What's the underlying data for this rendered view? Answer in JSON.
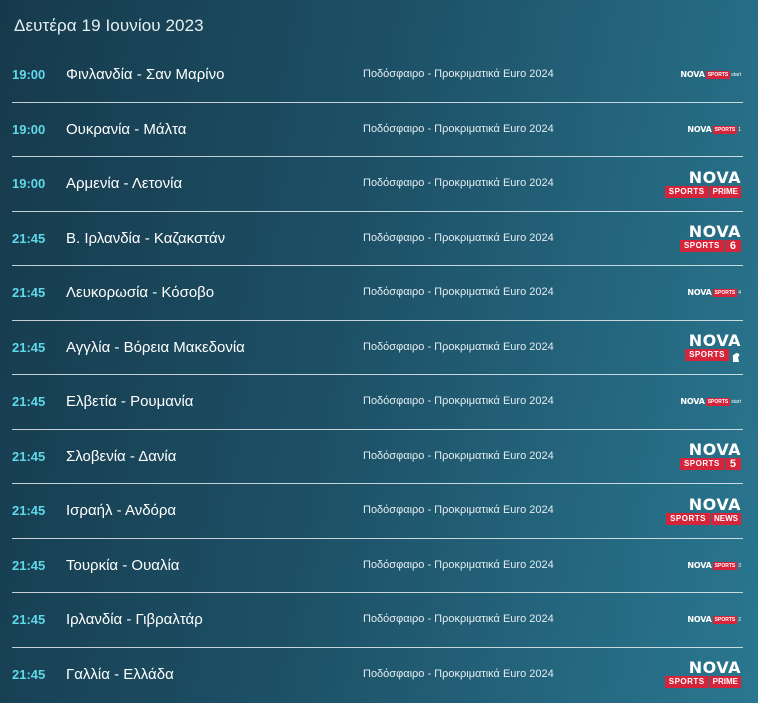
{
  "date_header": "Δευτέρα 19 Ιουνίου 2023",
  "colors": {
    "time": "#5fd9ea",
    "accent_red": "#d6243a",
    "divider": "#ffffff"
  },
  "matches": [
    {
      "time": "19:00",
      "teams": "Φινλανδία - Σαν Μαρίνο",
      "category": "Ποδόσφαιρο - Προκριματικά Euro 2024",
      "channel": {
        "style": "small",
        "nova": "NOVA",
        "sports": "SPORTS",
        "suffix": "start"
      }
    },
    {
      "time": "19:00",
      "teams": "Ουκρανία - Μάλτα",
      "category": "Ποδόσφαιρο - Προκριματικά Euro 2024",
      "channel": {
        "style": "small",
        "nova": "NOVA",
        "sports": "SPORTS",
        "suffix": "1"
      }
    },
    {
      "time": "19:00",
      "teams": "Αρμενία - Λετονία",
      "category": "Ποδόσφαιρο - Προκριματικά Euro 2024",
      "channel": {
        "style": "big",
        "nova": "NOVA",
        "sports": "SPORTS",
        "suffix": "PRIME"
      }
    },
    {
      "time": "21:45",
      "teams": "Β. Ιρλανδία - Καζακστάν",
      "category": "Ποδόσφαιρο - Προκριματικά Euro 2024",
      "channel": {
        "style": "big",
        "nova": "NOVA",
        "sports": "SPORTS",
        "suffix": "6"
      }
    },
    {
      "time": "21:45",
      "teams": "Λευκορωσία - Κόσοβο",
      "category": "Ποδόσφαιρο - Προκριματικά Euro 2024",
      "channel": {
        "style": "small",
        "nova": "NOVA",
        "sports": "SPORTS",
        "suffix": "4"
      }
    },
    {
      "time": "21:45",
      "teams": "Αγγλία - Βόρεια Μακεδονία",
      "category": "Ποδόσφαιρο - Προκριματικά Euro 2024",
      "channel": {
        "style": "big",
        "nova": "NOVA",
        "sports": "SPORTS",
        "suffix": "lion"
      }
    },
    {
      "time": "21:45",
      "teams": "Ελβετία - Ρουμανία",
      "category": "Ποδόσφαιρο - Προκριματικά Euro 2024",
      "channel": {
        "style": "small",
        "nova": "NOVA",
        "sports": "SPORTS",
        "suffix": "start"
      }
    },
    {
      "time": "21:45",
      "teams": "Σλοβενία - Δανία",
      "category": "Ποδόσφαιρο - Προκριματικά Euro 2024",
      "channel": {
        "style": "big",
        "nova": "NOVA",
        "sports": "SPORTS",
        "suffix": "5"
      }
    },
    {
      "time": "21:45",
      "teams": "Ισραήλ - Ανδόρα",
      "category": "Ποδόσφαιρο - Προκριματικά Euro 2024",
      "channel": {
        "style": "big",
        "nova": "NOVA",
        "sports": "SPORTS",
        "suffix": "NEWS"
      }
    },
    {
      "time": "21:45",
      "teams": "Τουρκία - Ουαλία",
      "category": "Ποδόσφαιρο - Προκριματικά Euro 2024",
      "channel": {
        "style": "small",
        "nova": "NOVA",
        "sports": "SPORTS",
        "suffix": "3"
      }
    },
    {
      "time": "21:45",
      "teams": "Ιρλανδία - Γιβραλτάρ",
      "category": "Ποδόσφαιρο - Προκριματικά Euro 2024",
      "channel": {
        "style": "small",
        "nova": "NOVA",
        "sports": "SPORTS",
        "suffix": "2"
      }
    },
    {
      "time": "21:45",
      "teams": "Γαλλία - Ελλάδα",
      "category": "Ποδόσφαιρο - Προκριματικά Euro 2024",
      "channel": {
        "style": "big",
        "nova": "NOVA",
        "sports": "SPORTS",
        "suffix": "PRIME"
      }
    }
  ]
}
